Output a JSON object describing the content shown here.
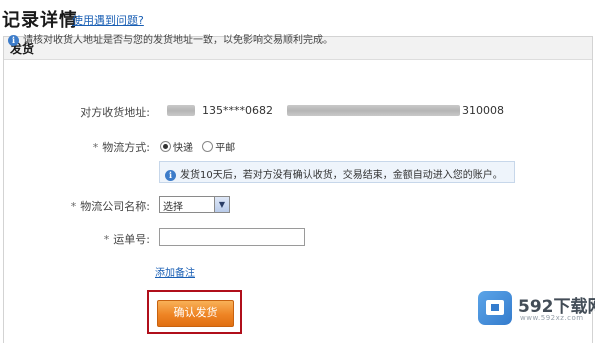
{
  "header": {
    "title": "记录详情",
    "help_link": "使用遇到问题?"
  },
  "panel": {
    "title": "发货",
    "notice": "请核对收货人地址是否与您的发货地址一致，以免影响交易顺利完成。"
  },
  "form": {
    "address_label": "对方收货地址:",
    "phone_masked": "135****0682",
    "postcode": "310008",
    "logistics_label": "物流方式:",
    "logistics_options": [
      "快递",
      "平邮"
    ],
    "logistics_selected": "快递",
    "tip": "发货10天后，若对方没有确认收货，交易结束，金额自动进入您的账户。",
    "company_label": "物流公司名称:",
    "company_selected": "选择",
    "tracking_label": "运单号:",
    "tracking_value": "",
    "add_note": "添加备注",
    "required_mark": "*",
    "confirm_button": "确认发货"
  },
  "watermark": {
    "name": "592下载网",
    "domain": "www.592xz.com"
  },
  "colors": {
    "link": "#1a5fb4",
    "button": "#ee8424",
    "highlight_border": "#b00f1b"
  }
}
